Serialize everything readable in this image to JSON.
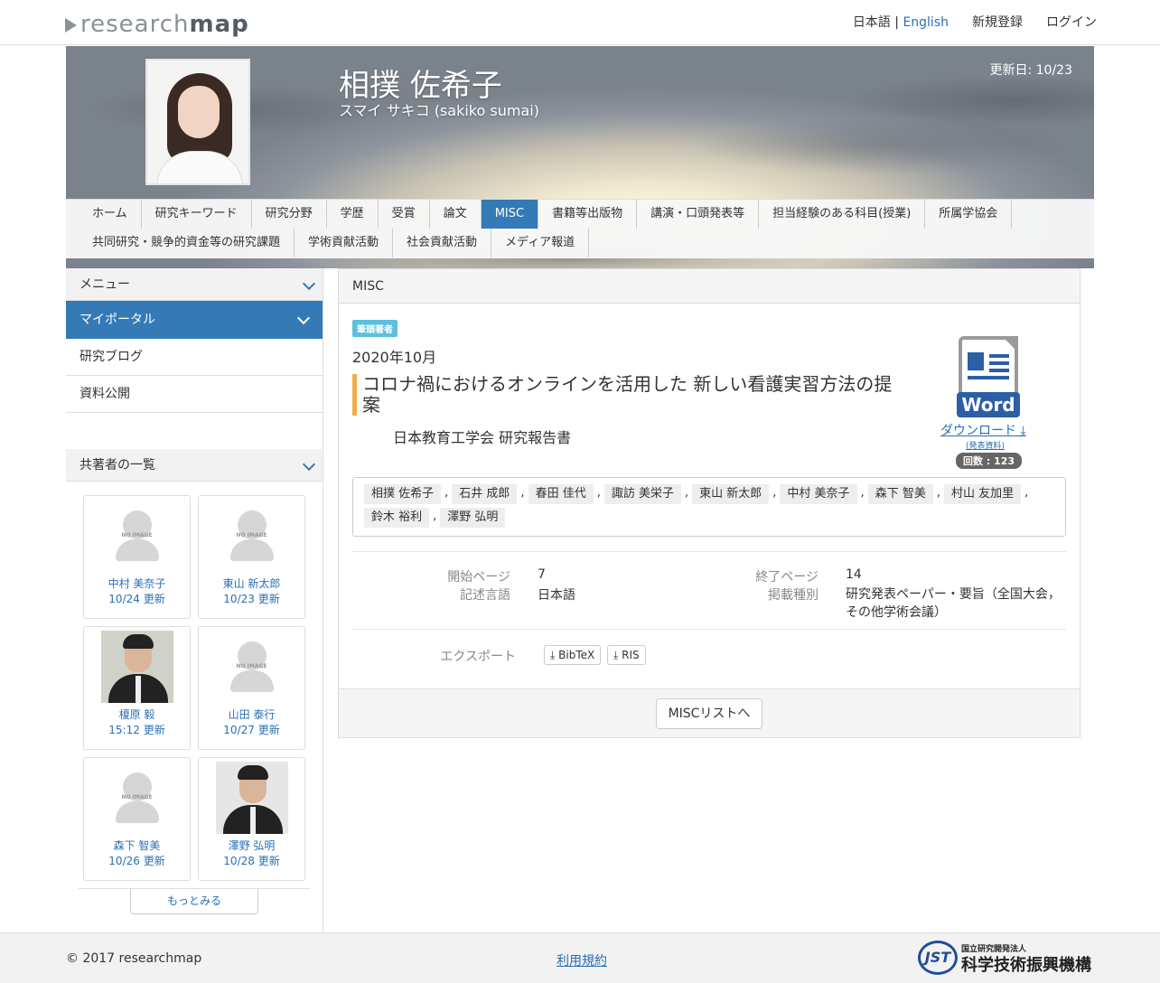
{
  "header": {
    "logo_light": "research",
    "logo_bold": "map",
    "lang_ja": "日本語",
    "lang_sep": "|",
    "lang_en": "English",
    "signup": "新規登録",
    "login": "ログイン"
  },
  "profile": {
    "name": "相撲 佐希子",
    "kana": "スマイ サキコ  (sakiko sumai)",
    "updated": "更新日: 10/23"
  },
  "tabs": {
    "row1": [
      "ホーム",
      "研究キーワード",
      "研究分野",
      "学歴",
      "受賞",
      "論文",
      "MISC",
      "書籍等出版物",
      "講演・口頭発表等",
      "担当経験のある科目(授業)",
      "所属学協会"
    ],
    "row2": [
      "共同研究・競争的資金等の研究課題",
      "学術貢献活動",
      "社会貢献活動",
      "メディア報道"
    ],
    "active": "MISC"
  },
  "sidebar": {
    "menu": "メニュー",
    "portal": "マイポータル",
    "items": [
      "研究ブログ",
      "資料公開"
    ],
    "coauthors_title": "共著者の一覧",
    "coauthors": [
      {
        "name": "中村 美奈子",
        "updated": "10/24 更新",
        "avatar": "no-image"
      },
      {
        "name": "東山 新太郎",
        "updated": "10/23 更新",
        "avatar": "no-image"
      },
      {
        "name": "榎原 毅",
        "updated": "15:12 更新",
        "avatar": "photo"
      },
      {
        "name": "山田 泰行",
        "updated": "10/27 更新",
        "avatar": "no-image"
      },
      {
        "name": "森下 智美",
        "updated": "10/26 更新",
        "avatar": "no-image"
      },
      {
        "name": "澤野 弘明",
        "updated": "10/28 更新",
        "avatar": "photo"
      }
    ],
    "no_image_text": "NO IMAGE",
    "more": "もっとみる"
  },
  "main": {
    "section": "MISC",
    "badge": "筆頭著者",
    "date": "2020年10月",
    "title": "コロナ禍におけるオンラインを活用した 新しい看護実習方法の提案",
    "journal": "日本教育工学会 研究報告書",
    "word_label": "Word",
    "download": "ダウンロード",
    "download_sub": "(発表資料)",
    "count": "回数 : 123",
    "authors": [
      "相撲 佐希子",
      "石井 成郎",
      "春田 佳代",
      "諏訪 美栄子",
      "東山 新太郎",
      "中村 美奈子",
      "森下 智美",
      "村山 友加里",
      "鈴木 裕利",
      "澤野 弘明"
    ],
    "fields": {
      "start_page_label": "開始ページ",
      "start_page": "7",
      "end_page_label": "終了ページ",
      "end_page": "14",
      "lang_label": "記述言語",
      "lang": "日本語",
      "type_label": "掲載種別",
      "type": "研究発表ペーパー・要旨（全国大会，その他学術会議）"
    },
    "export_label": "エクスポート",
    "export_bibtex": "BibTeX",
    "export_ris": "RIS",
    "list_button": "MISCリストへ"
  },
  "footer": {
    "copyright": "2017 researchmap",
    "terms": "利用規約",
    "jst_small": "国立研究開発法人",
    "jst_big": "科学技術振興機構",
    "jst_mark": "JST"
  },
  "colors": {
    "accent": "#337ab7",
    "badge": "#5bc0de",
    "title_bar": "#f0ad4e"
  }
}
